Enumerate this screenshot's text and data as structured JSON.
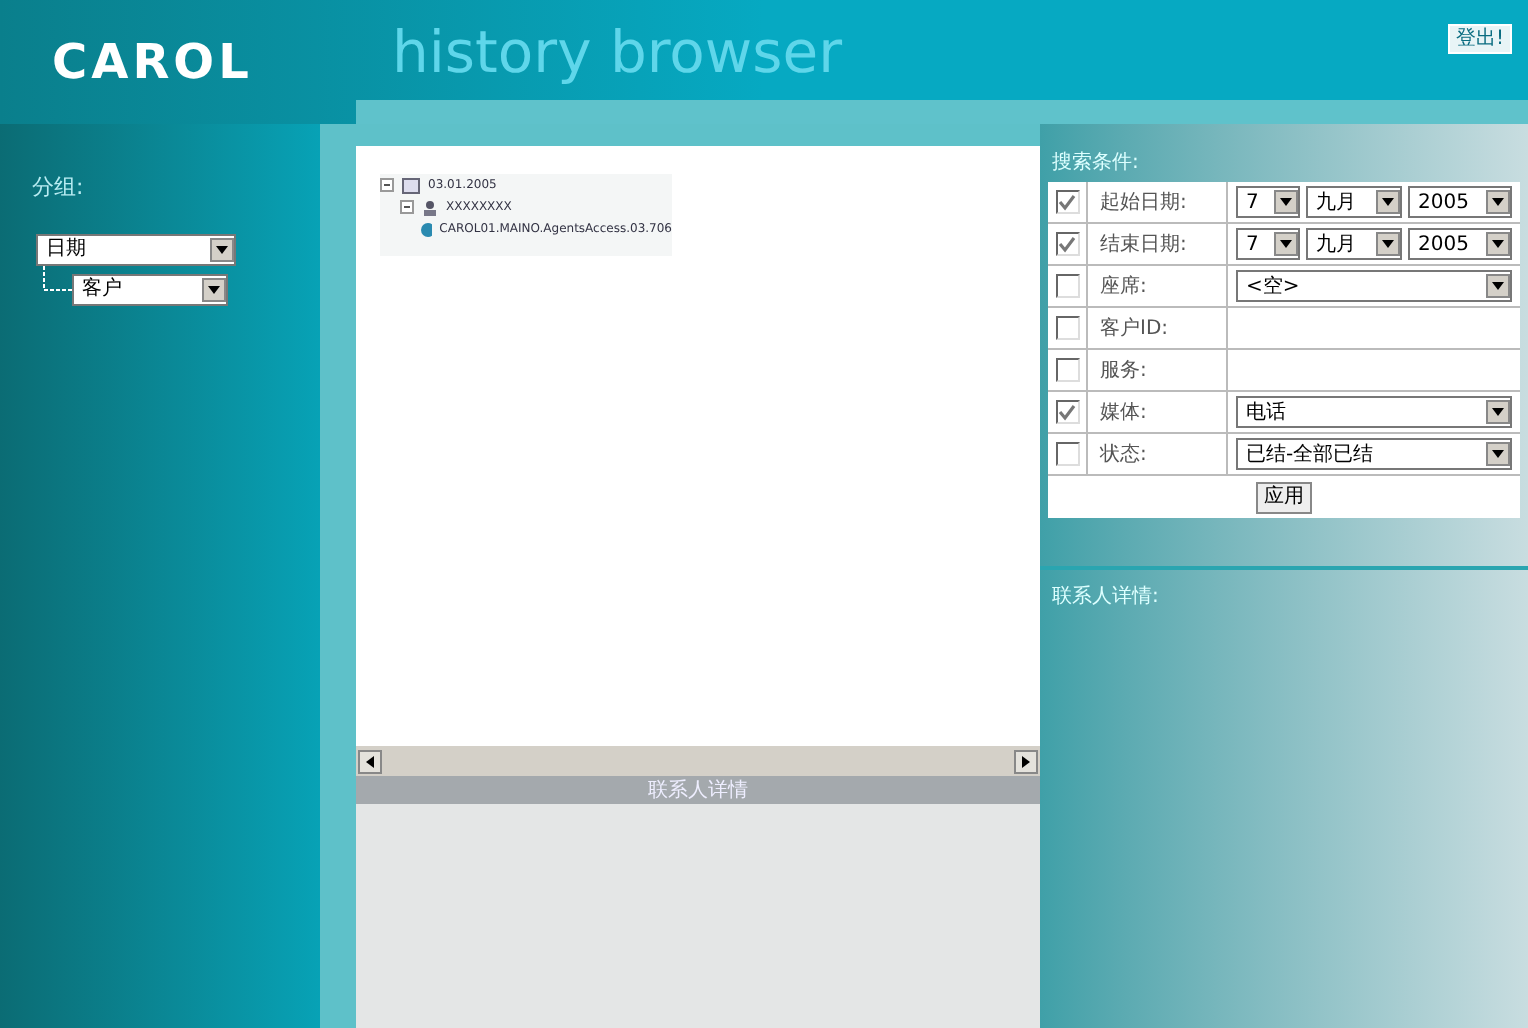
{
  "header": {
    "logo": "CAROL",
    "title": "history browser",
    "logout": "登出!"
  },
  "sidebar": {
    "label": "分组:",
    "group_select": "日期",
    "sub_select": "客户"
  },
  "tree": [
    {
      "label": "03.01.2005",
      "expanded": true,
      "children": [
        {
          "label": "XXXXXXXX",
          "expanded": true,
          "children": [
            {
              "label": "CAROL01.MAINO.AgentsAccess.03.706"
            }
          ]
        }
      ]
    }
  ],
  "contact_bar": "联系人详情",
  "search": {
    "title": "搜索条件:",
    "rows": [
      {
        "kind": "date",
        "label": "起始日期:",
        "checked": true,
        "day": "7",
        "month": "九月",
        "year": "2005"
      },
      {
        "kind": "date",
        "label": "结束日期:",
        "checked": true,
        "day": "7",
        "month": "九月",
        "year": "2005"
      },
      {
        "kind": "select",
        "label": "座席:",
        "checked": false,
        "value": "<空>"
      },
      {
        "kind": "text",
        "label": "客户ID:",
        "checked": false
      },
      {
        "kind": "text",
        "label": "服务:",
        "checked": false
      },
      {
        "kind": "select",
        "label": "媒体:",
        "checked": true,
        "value": "电话"
      },
      {
        "kind": "select",
        "label": "状态:",
        "checked": false,
        "value": "已结-全部已结"
      }
    ],
    "apply": "应用"
  },
  "details_title": "联系人详情:"
}
